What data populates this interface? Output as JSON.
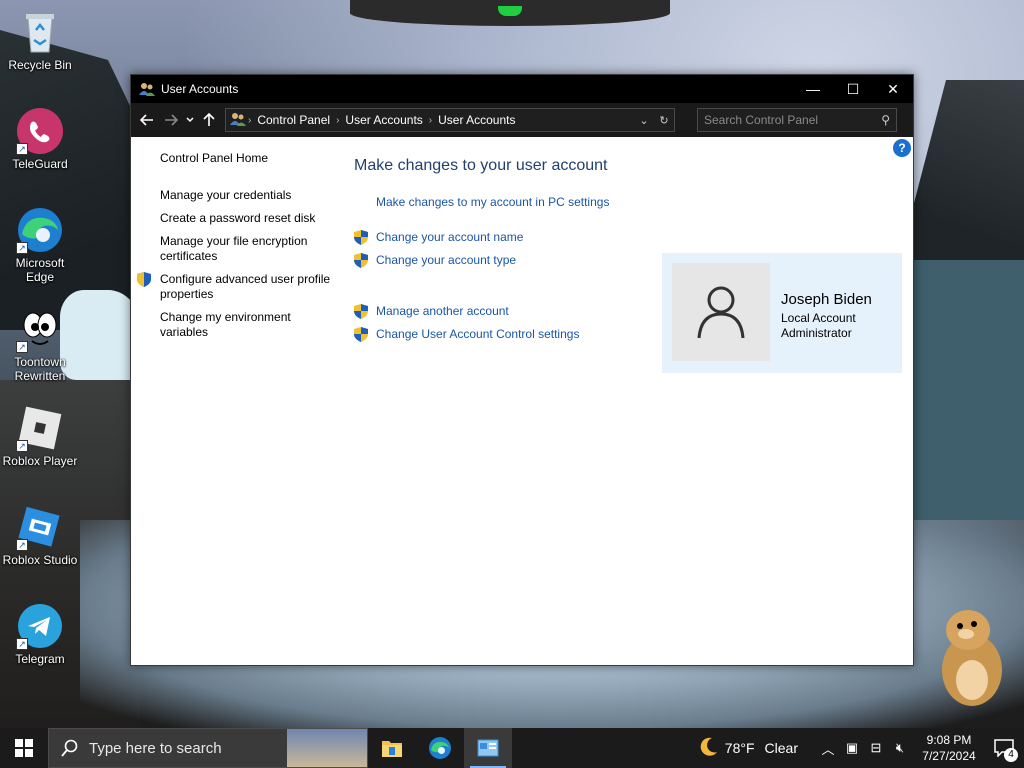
{
  "desktop": {
    "icons": [
      {
        "label": "Recycle Bin"
      },
      {
        "label": "TeleGuard"
      },
      {
        "label": "Microsoft Edge"
      },
      {
        "label": "Toontown Rewritten"
      },
      {
        "label": "Roblox Player"
      },
      {
        "label": "Roblox Studio"
      },
      {
        "label": "Telegram"
      }
    ]
  },
  "window": {
    "title": "User Accounts",
    "controls": {
      "minimize": "—",
      "maximize": "☐",
      "close": "✕"
    },
    "address": {
      "crumbs": [
        "Control Panel",
        "User Accounts",
        "User Accounts"
      ]
    },
    "search": {
      "placeholder": "Search Control Panel"
    },
    "left_pane": {
      "home": "Control Panel Home",
      "items": [
        "Manage your credentials",
        "Create a password reset disk",
        "Manage your file encryption certificates",
        "Configure advanced user profile properties",
        "Change my environment variables"
      ]
    },
    "main": {
      "heading": "Make changes to your user account",
      "pc_settings_link": "Make changes to my account in PC settings",
      "tasks_group1": [
        "Change your account name",
        "Change your account type"
      ],
      "tasks_group2": [
        "Manage another account",
        "Change User Account Control settings"
      ]
    },
    "user": {
      "name": "Joseph Biden",
      "type": "Local Account",
      "role": "Administrator"
    },
    "help_label": "?"
  },
  "taskbar": {
    "search_placeholder": "Type here to search",
    "weather": {
      "temp": "78°F",
      "condition": "Clear"
    },
    "clock": {
      "time": "9:08 PM",
      "date": "7/27/2024"
    },
    "notification_count": "4"
  },
  "colors": {
    "link": "#1a56a8",
    "heading": "#22406f",
    "user_card_bg": "#e6f2fb",
    "titlebar": "#000000",
    "taskbar": "#1b1b1b"
  }
}
